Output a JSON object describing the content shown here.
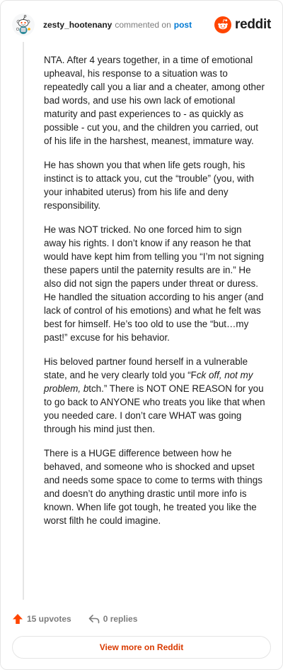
{
  "header": {
    "username": "zesty_hootenany",
    "action_text": "commented on",
    "post_link": "post",
    "logo_text": "reddit"
  },
  "comment": {
    "p1": "NTA. After 4 years together, in a time of emotional upheaval, his response to a situation was to repeatedly call you a liar and a cheater, among other bad words, and use his own lack of emotional maturity and past experiences to - as quickly as possible - cut you, and the children you carried, out of his life in the harshest, meanest, immature way.",
    "p2": "He has shown you that when life gets rough, his instinct is to attack you, cut the “trouble” (you, with your inhabited uterus) from his life and deny responsibility.",
    "p3": "He was NOT tricked. No one forced him to sign away his rights. I don’t know if any reason he that would have kept him from telling you “I’m not signing these papers until the paternity results are in.” He also did not sign the papers under threat or duress. He handled the situation according to his anger (and lack of control of his emotions) and what he felt was best for himself. He’s too old to use the “but…my past!” excuse for his behavior.",
    "p4_before": "His beloved partner found herself in a vulnerable state, and he very clearly told you “F",
    "p4_italic": "ck off, not my problem, b",
    "p4_after": "tch.” There is NOT ONE REASON for you to go back to ANYONE who treats you like that when you needed care. I don’t care WHAT was going through his mind just then.",
    "p5": "There is a HUGE difference between how he behaved, and someone who is shocked and upset and needs some space to come to terms with things and doesn’t do anything drastic until more info is known. When life got tough, he treated you like the worst filth he could imagine."
  },
  "footer": {
    "upvotes": "15 upvotes",
    "replies": "0 replies",
    "view_more": "View more on Reddit"
  },
  "colors": {
    "brand": "#ff4500",
    "link": "#0079d3",
    "view_more": "#d93a00",
    "muted": "#7c7c7c"
  },
  "icons": {
    "avatar": "snoo-avatar-icon",
    "logo": "reddit-snoo-icon",
    "upvote": "upvote-arrow-icon",
    "reply": "reply-arrow-icon"
  }
}
